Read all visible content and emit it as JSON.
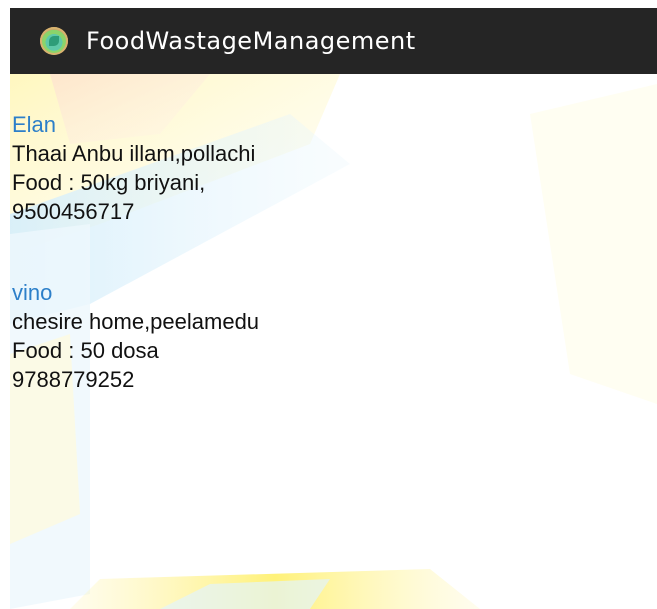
{
  "app": {
    "title": "FoodWastageManagement",
    "logo_icon": "app-logo-icon",
    "toolbar_color": "#252525"
  },
  "colors": {
    "name_accent": "#2c7fc9",
    "text": "#111111"
  },
  "entries": [
    {
      "name": "Elan",
      "address": "Thaai Anbu illam,pollachi",
      "food": "Food : 50kg briyani,",
      "phone": "9500456717"
    },
    {
      "name": "vino",
      "address": "chesire home,peelamedu",
      "food": "Food : 50 dosa",
      "phone": "9788779252"
    }
  ]
}
